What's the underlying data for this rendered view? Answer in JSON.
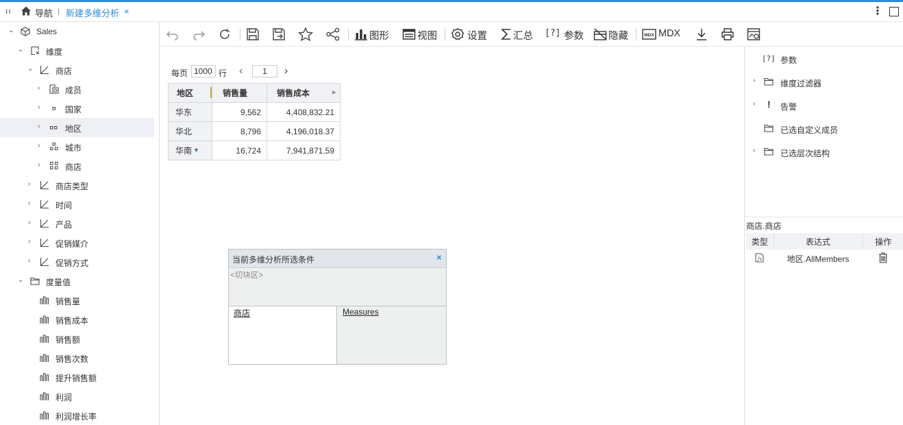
{
  "topbar": {
    "nav_label": "导航",
    "tab_label": "新建多维分析",
    "tab_close": "×",
    "menu_glyph": "ıı",
    "more_glyph": "⋮"
  },
  "tree": {
    "root": "Sales",
    "dimension_group": "维度",
    "dimensions": [
      {
        "label": "商店",
        "expanded": true
      },
      {
        "label": "成员"
      },
      {
        "label": "国家"
      },
      {
        "label": "地区",
        "selected": true
      },
      {
        "label": "城市"
      },
      {
        "label": "商店"
      },
      {
        "label": "商店类型"
      },
      {
        "label": "时间"
      },
      {
        "label": "产品"
      },
      {
        "label": "促销媒介"
      },
      {
        "label": "促销方式"
      }
    ],
    "measure_group": "度量值",
    "measures": [
      "销售量",
      "销售成本",
      "销售额",
      "销售次数",
      "提升销售额",
      "利润",
      "利润增长率"
    ]
  },
  "toolbar": {
    "chart": "图形",
    "view": "视图",
    "settings": "设置",
    "summary": "汇总",
    "params": "参数",
    "params_prefix": "[?]",
    "hide": "隐藏",
    "mdx": "MDX",
    "mdx_badge": "MDX"
  },
  "paging": {
    "per_page_label": "每页",
    "per_page_value": "1000",
    "rows_label": "行",
    "page_value": "1",
    "prev": "‹",
    "next": "›"
  },
  "grid": {
    "headers": [
      "地区",
      "销售量",
      "销售成本"
    ],
    "rows": [
      {
        "region": "华东",
        "qty": "9,562",
        "cost": "4,408,832.21"
      },
      {
        "region": "华北",
        "qty": "8,796",
        "cost": "4,196,018.37"
      },
      {
        "region": "华南",
        "qty": "16,724",
        "cost": "7,941,871.59"
      }
    ]
  },
  "dialog": {
    "title": "当前多维分析所选条件",
    "close": "×",
    "slicer_placeholder": "<切块区>",
    "rows_item": "商店",
    "cols_item": "Measures"
  },
  "rpanel": {
    "items": [
      {
        "label": "参数",
        "prefix": "[?]"
      },
      {
        "label": "维度过滤器"
      },
      {
        "label": "告警",
        "prefix": "!"
      },
      {
        "label": "已选自定义成员"
      },
      {
        "label": "已选层次结构"
      }
    ],
    "caption": "商店.商店",
    "headers": [
      "类型",
      "表达式",
      "操作"
    ],
    "rows": [
      {
        "expression": "地区.AllMembers"
      }
    ]
  },
  "colors": {
    "accent": "#2d8ad8",
    "header_bg": "#f0f2f5",
    "selected_bg": "#eef0f5"
  }
}
